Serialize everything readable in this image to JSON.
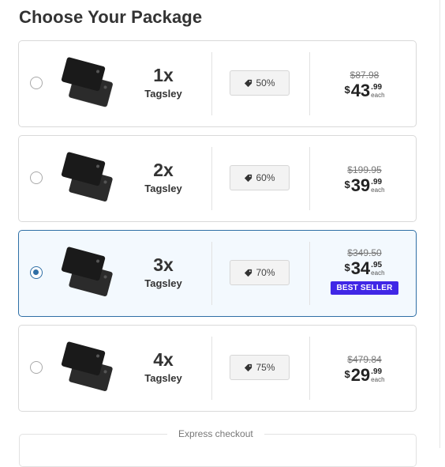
{
  "title": "Choose Your Package",
  "packages": [
    {
      "qty": "1x",
      "product": "Tagsley",
      "discount": "50%",
      "old_price": "$87.98",
      "currency": "$",
      "price_whole": "43",
      "price_cents": ".99",
      "each": "each",
      "selected": false,
      "badge": ""
    },
    {
      "qty": "2x",
      "product": "Tagsley",
      "discount": "60%",
      "old_price": "$199.95",
      "currency": "$",
      "price_whole": "39",
      "price_cents": ".99",
      "each": "each",
      "selected": false,
      "badge": ""
    },
    {
      "qty": "3x",
      "product": "Tagsley",
      "discount": "70%",
      "old_price": "$349.50",
      "currency": "$",
      "price_whole": "34",
      "price_cents": ".95",
      "each": "each",
      "selected": true,
      "badge": "BEST SELLER"
    },
    {
      "qty": "4x",
      "product": "Tagsley",
      "discount": "75%",
      "old_price": "$479.84",
      "currency": "$",
      "price_whole": "29",
      "price_cents": ".99",
      "each": "each",
      "selected": false,
      "badge": ""
    }
  ],
  "express_checkout": "Express checkout",
  "colors": {
    "accent": "#2f6fa6",
    "badge": "#4027e6",
    "selected_bg": "#f3f9fe"
  },
  "icons": {
    "discount": "tag-icon",
    "product": "card-image"
  }
}
